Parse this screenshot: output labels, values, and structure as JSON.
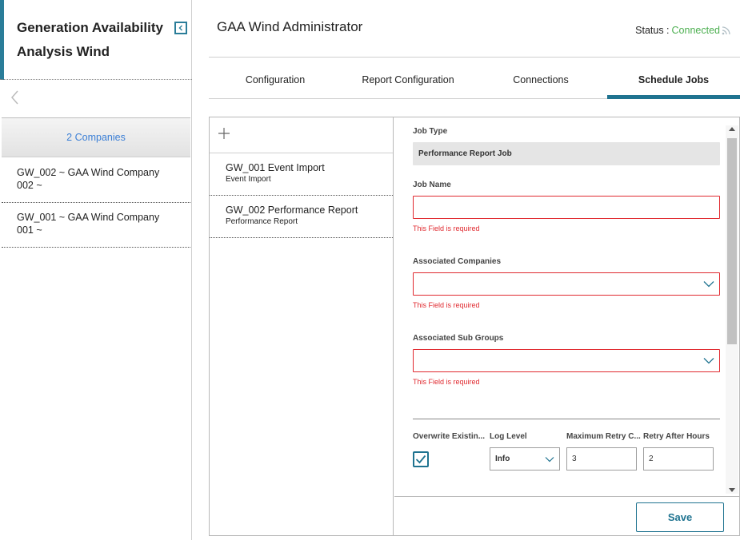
{
  "sidebar": {
    "title": "Generation Availability Analysis Wind",
    "companies_header": "2 Companies",
    "companies": [
      {
        "label": "GW_002 ~ GAA Wind Company 002 ~"
      },
      {
        "label": "GW_001 ~ GAA Wind Company 001 ~"
      }
    ]
  },
  "header": {
    "title": "GAA Wind Administrator",
    "status_label": "Status :",
    "status_value": "Connected"
  },
  "tabs": [
    {
      "label": "Configuration",
      "active": false
    },
    {
      "label": "Report Configuration",
      "active": false
    },
    {
      "label": "Connections",
      "active": false
    },
    {
      "label": "Schedule Jobs",
      "active": true
    }
  ],
  "jobs": [
    {
      "name": "GW_001 Event Import",
      "type": "Event Import"
    },
    {
      "name": "GW_002 Performance Report",
      "type": "Performance Report"
    }
  ],
  "form": {
    "job_type_label": "Job Type",
    "job_type_value": "Performance Report Job",
    "job_name_label": "Job Name",
    "job_name_value": "",
    "associated_companies_label": "Associated Companies",
    "associated_companies_value": "",
    "associated_sub_groups_label": "Associated Sub Groups",
    "associated_sub_groups_value": "",
    "required_error": "This Field is required",
    "overwrite_label": "Overwrite Existin...",
    "overwrite_checked": true,
    "log_level_label": "Log Level",
    "log_level_value": "Info",
    "max_retry_label": "Maximum Retry C...",
    "max_retry_value": "3",
    "retry_after_label": "Retry After Hours",
    "retry_after_value": "2",
    "save_label": "Save"
  },
  "colors": {
    "accent": "#1f7390",
    "error": "#e0292f",
    "connected": "#4caf50",
    "link": "#3b7fd6"
  }
}
